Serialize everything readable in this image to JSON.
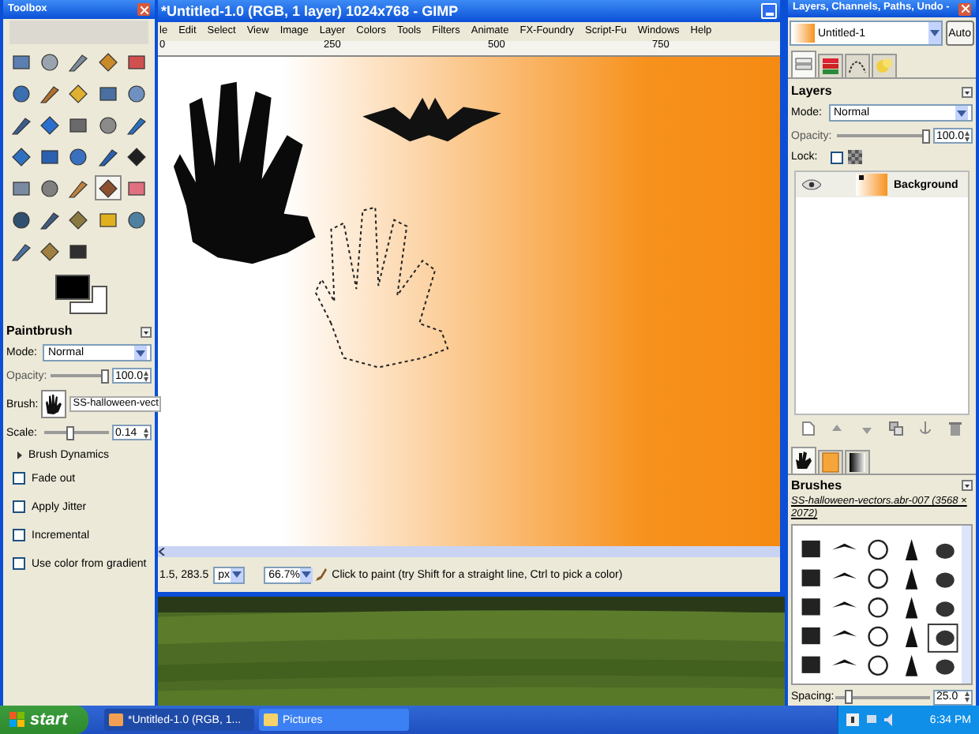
{
  "toolbox": {
    "title": "Toolbox",
    "tools": [
      {
        "selected": false
      },
      {
        "selected": false
      },
      {
        "selected": false
      },
      {
        "selected": false
      },
      {
        "selected": false
      },
      {
        "selected": false
      },
      {
        "selected": false
      },
      {
        "selected": false
      },
      {
        "selected": false
      },
      {
        "selected": false
      },
      {
        "selected": false
      },
      {
        "selected": false
      },
      {
        "selected": false
      },
      {
        "selected": false
      },
      {
        "selected": false
      },
      {
        "selected": false
      },
      {
        "selected": false
      },
      {
        "selected": false
      },
      {
        "selected": false
      },
      {
        "selected": false
      },
      {
        "selected": false
      },
      {
        "selected": false
      },
      {
        "selected": false
      },
      {
        "selected": true
      },
      {
        "selected": false
      },
      {
        "selected": false
      },
      {
        "selected": false
      },
      {
        "selected": false
      },
      {
        "selected": false
      },
      {
        "selected": false
      },
      {
        "selected": false
      },
      {
        "selected": false
      },
      {
        "selected": false
      }
    ]
  },
  "tool_options": {
    "title": "Paintbrush",
    "mode_label": "Mode:",
    "mode": "Normal",
    "opacity_label": "Opacity:",
    "opacity": {
      "value": "100.0",
      "level": 1
    },
    "brush_label": "Brush:",
    "brush": "SS-halloween-vect",
    "scale_label": "Scale:",
    "scale": {
      "value": "0.14",
      "level": 0.4
    },
    "brush_dynamics": {
      "label": "Brush Dynamics",
      "expanded": false
    },
    "options": [
      {
        "label": "Fade out",
        "checked": false
      },
      {
        "label": "Apply Jitter",
        "checked": false
      },
      {
        "label": "Incremental",
        "checked": false
      },
      {
        "label": "Use color from gradient",
        "checked": false
      }
    ]
  },
  "image_window": {
    "title": "*Untitled-1.0 (RGB, 1 layer) 1024x768 - GIMP",
    "menu": [
      "le",
      "Edit",
      "Select",
      "View",
      "Image",
      "Layer",
      "Colors",
      "Tools",
      "Filters",
      "Animate",
      "FX-Foundry",
      "Script-Fu",
      "Windows",
      "Help"
    ],
    "ruler": [
      "0",
      "250",
      "500",
      "750"
    ],
    "status": {
      "coords": "1.5, 283.5",
      "unit": "px",
      "zoom": "66.7%",
      "message": "Click to paint (try Shift for a straight line, Ctrl to pick a color)"
    }
  },
  "dock": {
    "title": "Layers, Channels, Paths, Undo -",
    "image": "Untitled-1",
    "auto": "Auto",
    "tabs": [
      {
        "kind": "layers",
        "selected": true
      },
      {
        "kind": "channels",
        "selected": false
      },
      {
        "kind": "paths",
        "selected": false
      },
      {
        "kind": "undo",
        "selected": false
      }
    ],
    "layers_title": "Layers",
    "mode_label": "Mode:",
    "mode": "Normal",
    "opacity_label": "Opacity:",
    "opacity": {
      "value": "100.0",
      "level": 1
    },
    "lock_label": "Lock:",
    "lock_alpha": false,
    "layers": [
      {
        "name": "Background",
        "visible": true
      }
    ],
    "brush_tabs": [
      {
        "kind": "brushes",
        "selected": true
      },
      {
        "kind": "patterns",
        "selected": false
      },
      {
        "kind": "gradients",
        "selected": false
      }
    ],
    "brushes_title": "Brushes",
    "brush_name": "SS-halloween-vectors.abr-007 (3568 × 2072)",
    "spacing_label": "Spacing:",
    "spacing": {
      "value": "25.0",
      "level": 0.1
    }
  },
  "taskbar": {
    "start": "start",
    "tasks": [
      {
        "label": "*Untitled-1.0 (RGB, 1...",
        "selected": true
      },
      {
        "label": "Pictures",
        "selected": false
      }
    ],
    "clock": "6:34 PM"
  }
}
